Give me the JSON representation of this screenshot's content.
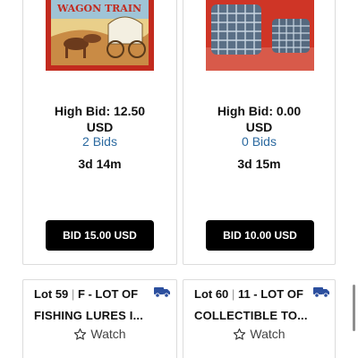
{
  "colors": {
    "link_blue": "#2c6aa0",
    "button_black": "#000000",
    "truck_blue": "#2c4f9e"
  },
  "cards": [
    {
      "image_name": "wagon-train-lunchbox-image",
      "image_text": "WAGON TRAIN",
      "high_bid": "High Bid: 12.50",
      "currency": "USD",
      "bids": "2 Bids",
      "time_left": "3d 14m",
      "bid_button": "BID 15.00 USD"
    },
    {
      "image_name": "blue-basket-pottery-image",
      "high_bid": "High Bid: 0.00",
      "currency": "USD",
      "bids": "0 Bids",
      "time_left": "3d 15m",
      "bid_button": "BID 10.00 USD"
    }
  ],
  "lots": [
    {
      "lot": "Lot 59",
      "sep": "|",
      "category": "F - LOT OF",
      "title_line2": "FISHING LURES I...",
      "watch": "Watch",
      "icon": "truck-icon"
    },
    {
      "lot": "Lot 60",
      "sep": "|",
      "category": "11 - LOT OF",
      "title_line2": "COLLECTIBLE TO...",
      "watch": "Watch",
      "icon": "truck-icon"
    }
  ]
}
